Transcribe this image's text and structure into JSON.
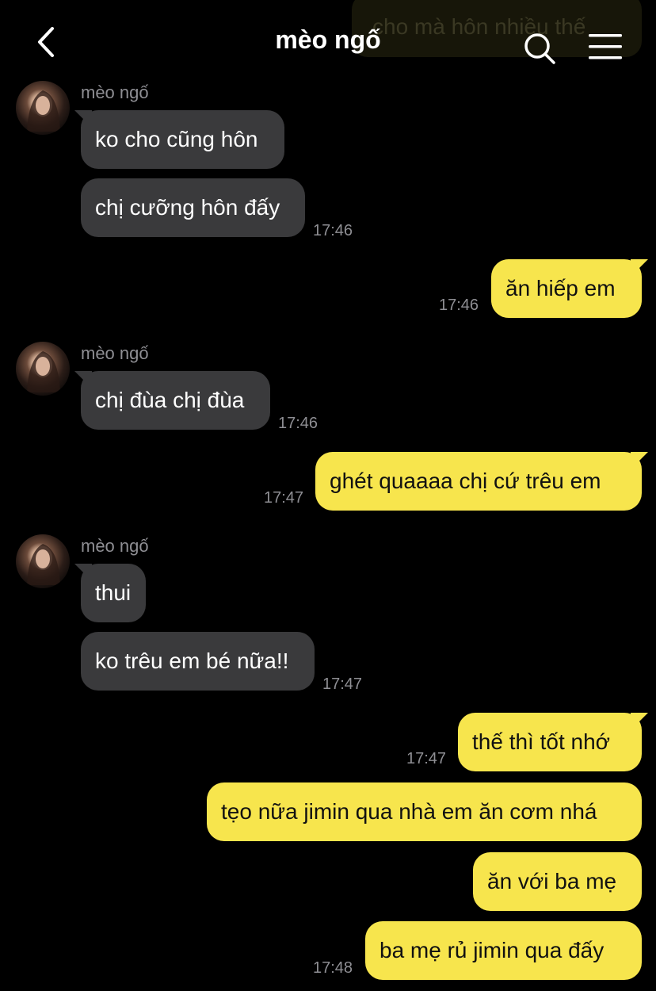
{
  "header": {
    "title": "mèo ngố",
    "prev_message_fragment": "cho mà hôn nhiều thế"
  },
  "messages": [
    {
      "sender": "mèo ngố",
      "text": "ko cho cũng hôn"
    },
    {
      "text": "chị cưỡng hôn đấy",
      "time": "17:46"
    },
    {
      "text": "ăn hiếp em",
      "time": "17:46"
    },
    {
      "sender": "mèo ngố",
      "text": "chị đùa chị đùa",
      "time": "17:46"
    },
    {
      "text": "ghét quaaaa chị cứ trêu em",
      "time": "17:47"
    },
    {
      "sender": "mèo ngố",
      "text": "thui"
    },
    {
      "text": "ko trêu em bé nữa!!",
      "time": "17:47"
    },
    {
      "text": "thế thì tốt nhớ",
      "time": "17:47"
    },
    {
      "text": "tẹo nữa jimin qua nhà em ăn cơm nhá"
    },
    {
      "text": "ăn với ba mẹ"
    },
    {
      "text": "ba mẹ rủ jimin qua đấy",
      "time": "17:48"
    }
  ],
  "colors": {
    "background": "#000000",
    "incoming_bubble": "#3a3a3c",
    "outgoing_bubble": "#f7e54d",
    "timestamp": "#8e8e93"
  },
  "icons": [
    "chevron-left-icon",
    "search-icon",
    "hamburger-menu-icon"
  ]
}
